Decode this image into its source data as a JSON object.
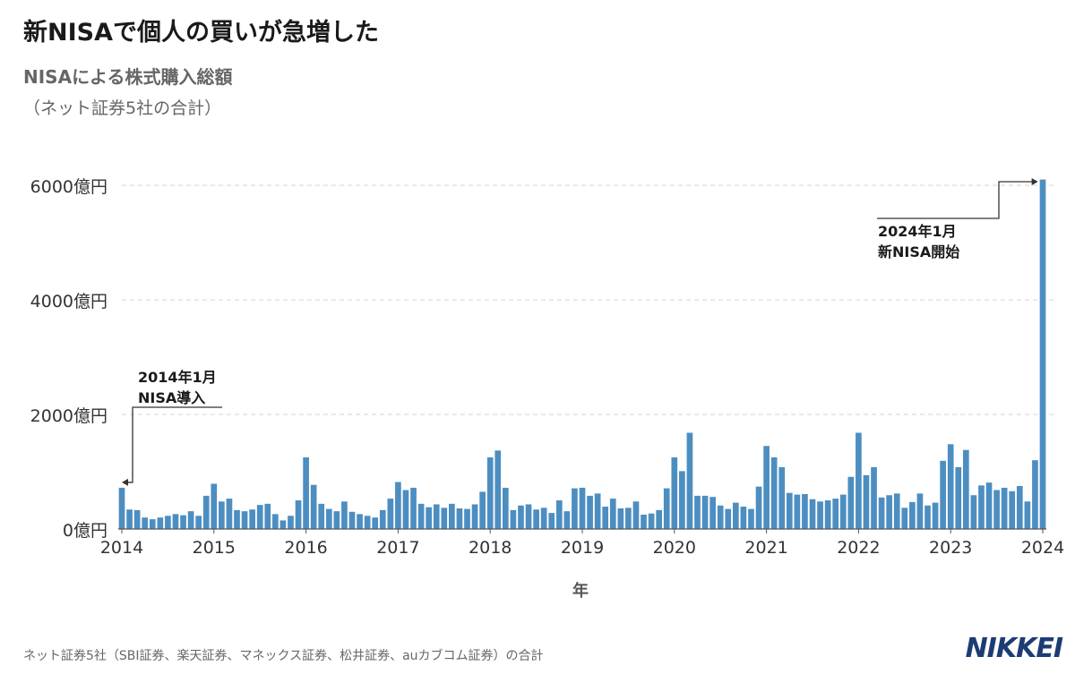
{
  "header": {
    "headline": "新NISAで個人の買いが急増した",
    "subtitle": "NISAによる株式購入総額",
    "subtitle2": "（ネット証券5社の合計）"
  },
  "footer": {
    "note": "ネット証券5社（SBI証券、楽天証券、マネックス証券、松井証券、auカブコム証券）の合計",
    "logo": "NIKKEI"
  },
  "chart_data": {
    "type": "bar",
    "xlabel": "年",
    "ylabel": "",
    "ylim": [
      0,
      6000
    ],
    "y_ticks": [
      0,
      2000,
      4000,
      6000
    ],
    "y_tick_labels": [
      "0億円",
      "2000億円",
      "4000億円",
      "6000億円"
    ],
    "x_tick_labels": [
      "2014",
      "2015",
      "2016",
      "2017",
      "2018",
      "2019",
      "2020",
      "2021",
      "2022",
      "2023",
      "2024"
    ],
    "grid": true,
    "bar_color": "#4d8ec1",
    "start": "2014-01",
    "values": [
      720,
      340,
      330,
      200,
      170,
      200,
      230,
      260,
      240,
      310,
      230,
      580,
      790,
      480,
      530,
      330,
      310,
      340,
      420,
      440,
      260,
      150,
      230,
      500,
      1250,
      770,
      440,
      350,
      310,
      480,
      300,
      260,
      230,
      200,
      330,
      530,
      820,
      680,
      720,
      440,
      380,
      430,
      370,
      440,
      360,
      350,
      430,
      650,
      1250,
      1370,
      720,
      330,
      410,
      430,
      340,
      370,
      280,
      500,
      310,
      710,
      720,
      580,
      620,
      390,
      530,
      360,
      370,
      480,
      250,
      270,
      330,
      710,
      1250,
      1010,
      1680,
      580,
      580,
      560,
      410,
      350,
      460,
      390,
      350,
      740,
      1450,
      1250,
      1080,
      630,
      600,
      610,
      520,
      480,
      500,
      530,
      600,
      910,
      1680,
      940,
      1080,
      550,
      590,
      620,
      370,
      470,
      620,
      410,
      460,
      1190,
      1480,
      1080,
      1380,
      590,
      760,
      810,
      680,
      720,
      660,
      750,
      480,
      1200,
      6100
    ],
    "annotations": [
      {
        "lines": [
          "2014年1月",
          "NISA導入"
        ],
        "target": "2014-01"
      },
      {
        "lines": [
          "2024年1月",
          "新NISA開始"
        ],
        "target": "2024-01"
      }
    ]
  }
}
